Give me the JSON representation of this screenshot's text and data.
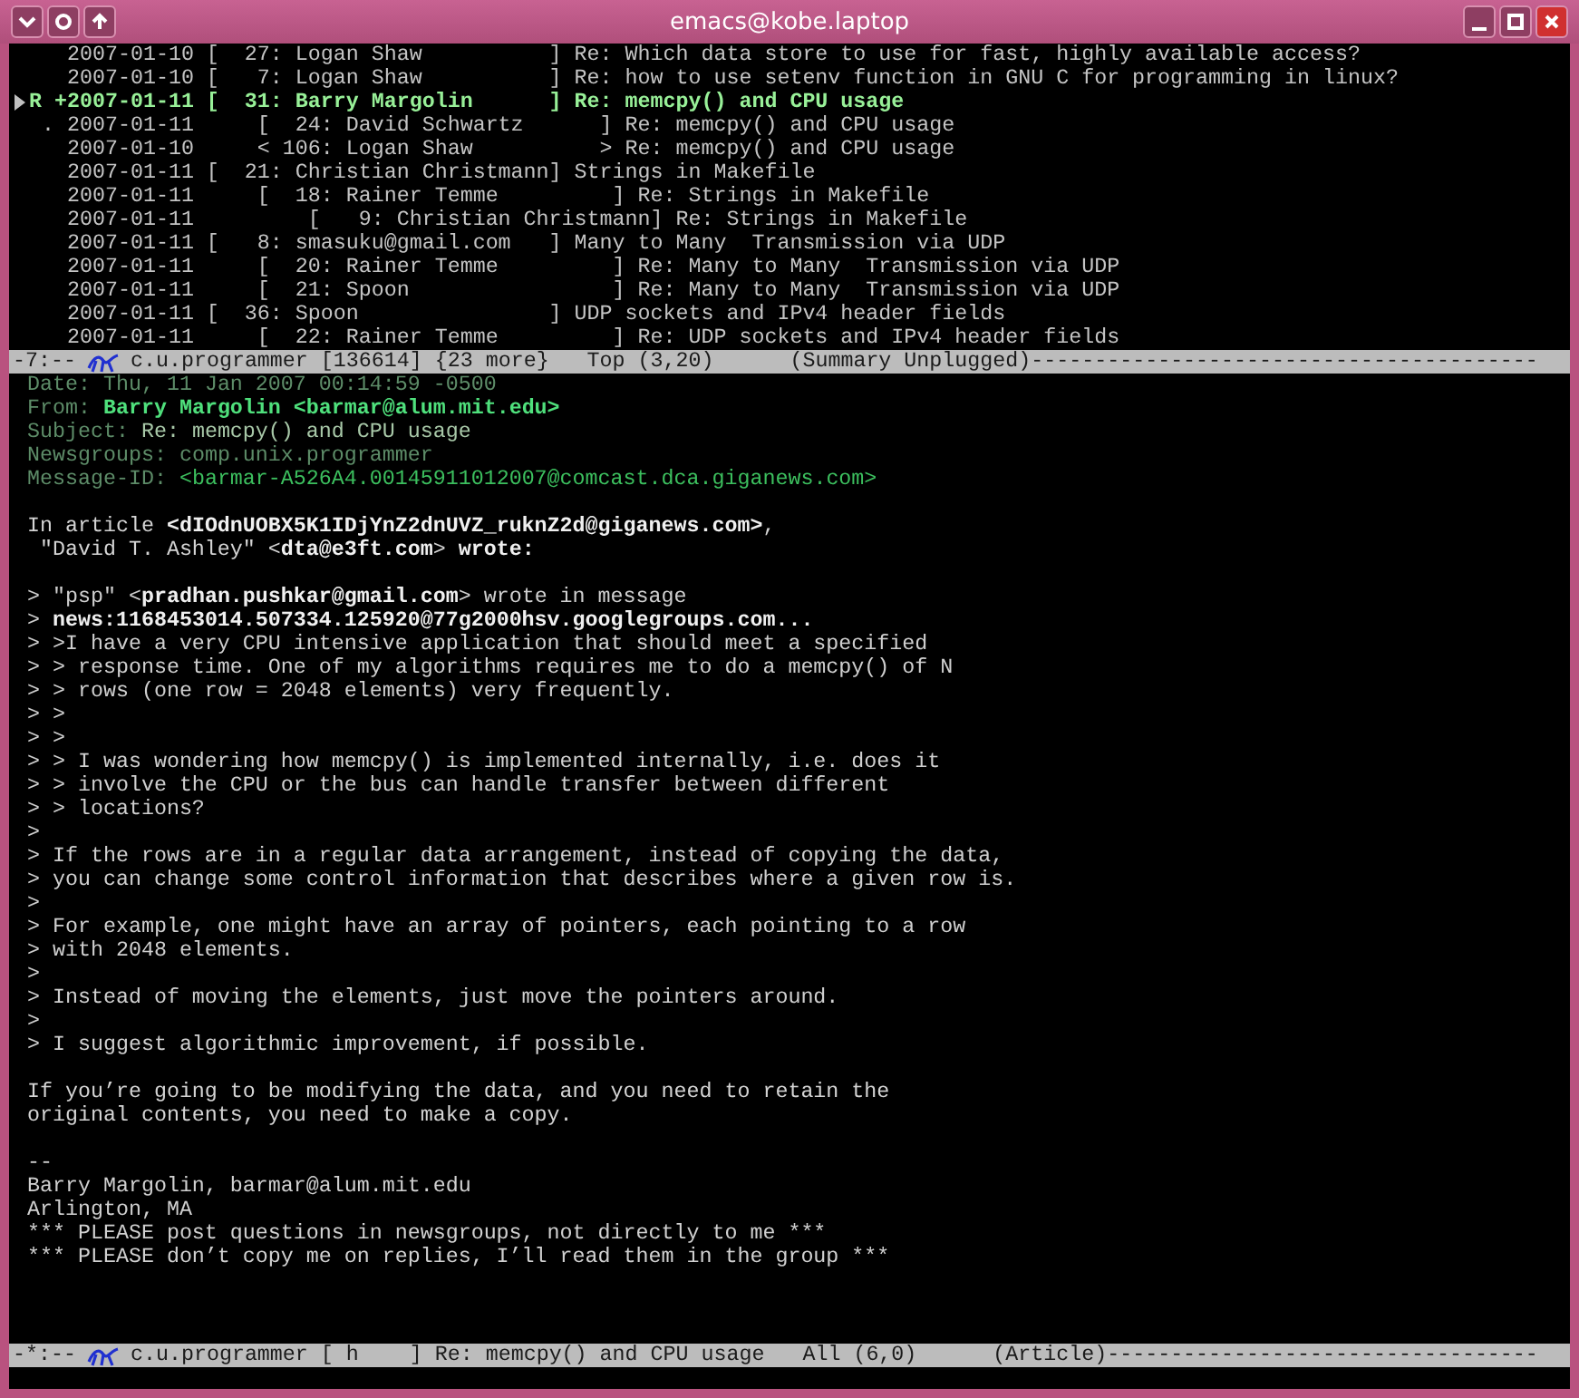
{
  "window": {
    "title": "emacs@kobe.laptop"
  },
  "summary": {
    "lines": [
      {
        "text": "   2007-01-10 [  27: Logan Shaw          ] Re: Which data store to use for fast, highly available access?",
        "selected": false
      },
      {
        "text": "   2007-01-10 [   7: Logan Shaw          ] Re: how to use setenv function in GNU C for programming in linux?",
        "selected": false
      },
      {
        "text": "R +2007-01-11 [  31: Barry Margolin      ] Re: memcpy() and CPU usage",
        "selected": true
      },
      {
        "text": " . 2007-01-11     [  24: David Schwartz      ] Re: memcpy() and CPU usage",
        "selected": false
      },
      {
        "text": "   2007-01-10     < 106: Logan Shaw          > Re: memcpy() and CPU usage",
        "selected": false
      },
      {
        "text": "   2007-01-11 [  21: Christian Christmann] Strings in Makefile",
        "selected": false
      },
      {
        "text": "   2007-01-11     [  18: Rainer Temme         ] Re: Strings in Makefile",
        "selected": false
      },
      {
        "text": "   2007-01-11         [   9: Christian Christmann] Re: Strings in Makefile",
        "selected": false
      },
      {
        "text": "   2007-01-11 [   8: smasuku@gmail.com   ] Many to Many  Transmission via UDP",
        "selected": false
      },
      {
        "text": "   2007-01-11     [  20: Rainer Temme         ] Re: Many to Many  Transmission via UDP",
        "selected": false
      },
      {
        "text": "   2007-01-11     [  21: Spoon                ] Re: Many to Many  Transmission via UDP",
        "selected": false
      },
      {
        "text": "   2007-01-11 [  36: Spoon               ] UDP sockets and IPv4 header fields",
        "selected": false
      },
      {
        "text": "   2007-01-11     [  22: Rainer Temme         ] Re: UDP sockets and IPv4 header fields",
        "selected": false
      }
    ]
  },
  "summary_mode_line": {
    "flags": "-7:--",
    "text": "c.u.programmer [136614] {23 more}   Top (3,20)      (Summary Unplugged)----------------------------------------"
  },
  "article": {
    "headers": [
      {
        "kind": "date",
        "label": "Date:",
        "value": "Thu, 11 Jan 2007 00:14:59 -0500"
      },
      {
        "kind": "from",
        "label": "From:",
        "value": "Barry Margolin <barmar@alum.mit.edu>"
      },
      {
        "kind": "subject",
        "label": "Subject:",
        "value": "Re: memcpy() and CPU usage"
      },
      {
        "kind": "newsgroups",
        "label": "Newsgroups:",
        "value": "comp.unix.programmer"
      },
      {
        "kind": "message_id",
        "label": "Message-ID:",
        "value": "<barmar-A526A4.00145911012007@comcast.dca.giganews.com>"
      }
    ],
    "paragraphs": [
      {
        "kind": "attribution",
        "lines": [
          "In article **<dIOdnUOBX5K1IDjYnZ2dnUVZ_ruknZ2d@giganews.com>**,",
          " \"David T. Ashley\" <**dta@e3ft.com**> **wrote:**"
        ]
      },
      {
        "kind": "quote",
        "lines": [
          "> \"psp\" <**pradhan.pushkar@gmail.com**> wrote in message",
          "> **news:1168453014.507334.125920@77g2000hsv.googlegroups.com...**",
          "> >I have a very CPU intensive application that should meet a specified",
          "> > response time. One of my algorithms requires me to do a memcpy() of N",
          "> > rows (one row = 2048 elements) very frequently.",
          "> >",
          "> >",
          "> > I was wondering how memcpy() is implemented internally, i.e. does it",
          "> > involve the CPU or the bus can handle transfer between different",
          "> > locations?",
          ">",
          "> If the rows are in a regular data arrangement, instead of copying the data,",
          "> you can change some control information that describes where a given row is.",
          ">",
          "> For example, one might have an array of pointers, each pointing to a row",
          "> with 2048 elements.",
          ">",
          "> Instead of moving the elements, just move the pointers around.",
          ">",
          "> I suggest algorithmic improvement, if possible."
        ]
      },
      {
        "kind": "text",
        "lines": [
          "If you’re going to be modifying the data, and you need to retain the",
          "original contents, you need to make a copy."
        ]
      },
      {
        "kind": "signature",
        "lines": [
          "--",
          "Barry Margolin, barmar@alum.mit.edu",
          "Arlington, MA",
          "*** PLEASE post questions in newsgroups, not directly to me ***",
          "*** PLEASE don’t copy me on replies, I’ll read them in the group ***"
        ]
      }
    ]
  },
  "article_mode_line": {
    "flags": "-*:--",
    "text": "c.u.programmer [ h    ] Re: memcpy() and CPU usage   All (6,0)      (Article)----------------------------------"
  }
}
